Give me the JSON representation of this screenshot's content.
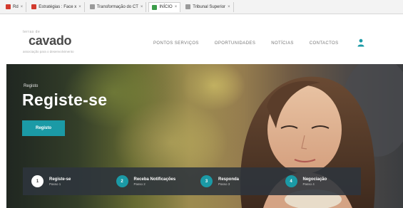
{
  "browser": {
    "tabs": [
      {
        "label": "Rd",
        "favicon_color": "#d23b2e",
        "active": false
      },
      {
        "label": "Estratégias : Face x",
        "favicon_color": "#d23b2e",
        "active": false
      },
      {
        "label": "Transformação do CT",
        "favicon_color": "#9a9a9a",
        "active": false
      },
      {
        "label": "INÍCIO",
        "favicon_color": "#3c9d4a",
        "active": true
      },
      {
        "label": "Tribunal Superior",
        "favicon_color": "#9a9a9a",
        "active": false
      }
    ],
    "close_glyph": "×"
  },
  "header": {
    "logo": {
      "top_text": "terras de",
      "main_text": "cavado",
      "tagline": "associação para o desenvolvimento"
    },
    "nav": [
      {
        "label": "PONTOS SERVIÇOS"
      },
      {
        "label": "OPORTUNIDADES"
      },
      {
        "label": "NOTÍCIAS"
      },
      {
        "label": "CONTACTOS"
      }
    ],
    "nav_icon": "user-icon",
    "accent_color": "#1b9aa6"
  },
  "hero": {
    "breadcrumb": "Registo",
    "title": "Registe-se",
    "cta_label": "Registo"
  },
  "steps": [
    {
      "number": "1",
      "title": "Registe-se",
      "subtitle": "Passo 1",
      "active": true
    },
    {
      "number": "2",
      "title": "Receba Notificações",
      "subtitle": "Passo 2",
      "active": false
    },
    {
      "number": "3",
      "title": "Responda",
      "subtitle": "Passo 3",
      "active": false
    },
    {
      "number": "4",
      "title": "Negociação",
      "subtitle": "Passo 4",
      "active": false
    }
  ]
}
